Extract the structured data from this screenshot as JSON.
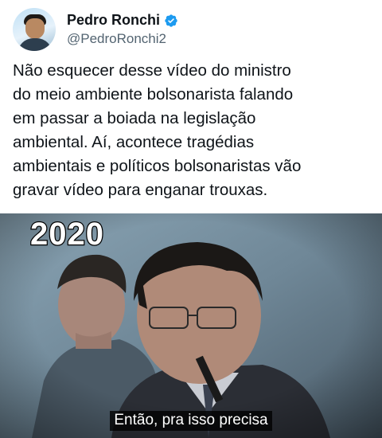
{
  "author": {
    "display_name": "Pedro Ronchi",
    "handle": "@PedroRonchi2",
    "verified_icon": "verified-badge-icon",
    "verified_color": "#1d9bf0"
  },
  "tweet": {
    "lines": [
      "Não esquecer desse vídeo do ministro",
      "do meio ambiente bolsonarista falando",
      "em passar a boiada na legislação",
      "ambiental. Aí, acontece tragédias",
      "ambientais e políticos bolsonaristas vão",
      "gravar vídeo para enganar trouxas."
    ]
  },
  "video": {
    "year_overlay": "2020",
    "subtitle": "Então, pra isso precisa"
  },
  "colors": {
    "text_primary": "#0f1419",
    "text_secondary": "#536471",
    "background": "#ffffff"
  }
}
